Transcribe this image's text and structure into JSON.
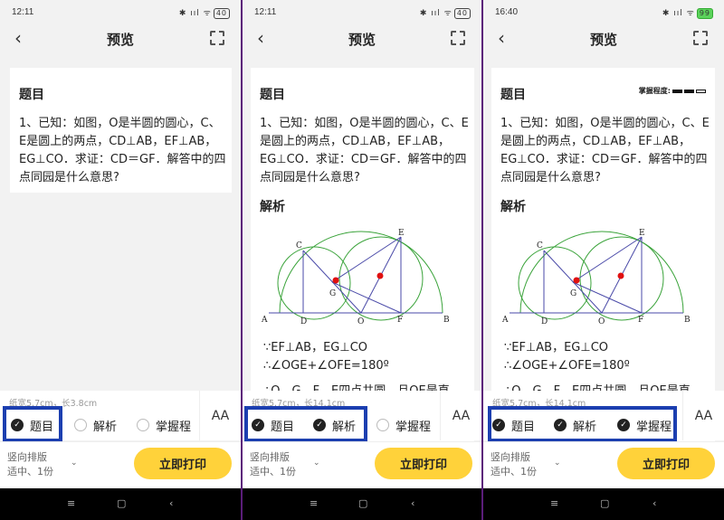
{
  "screens": [
    {
      "status": {
        "time": "12:11",
        "icons": "✱ ııl ᯤ",
        "battery": "40"
      },
      "nav": {
        "title": "预览",
        "back": "‹"
      },
      "card": {
        "heading": "题目",
        "question": "1、已知：如图，O是半圆的圆心，C、E是圆上的两点，CD⊥AB，EF⊥AB，EG⊥CO．求证：CD＝GF．解答中的四点同园是什么意思?"
      },
      "controls": {
        "paper": "纸宽5.7cm，长3.8cm",
        "options": [
          {
            "label": "题目",
            "checked": true
          },
          {
            "label": "解析",
            "checked": false
          },
          {
            "label": "掌握程",
            "checked": false
          }
        ],
        "font_button": "AA"
      },
      "bottom": {
        "layout1": "竖向排版",
        "layout2": "适中、1份",
        "print": "立即打印"
      }
    },
    {
      "status": {
        "time": "12:11",
        "icons": "✱ ııl ᯤ",
        "battery": "40"
      },
      "nav": {
        "title": "预览",
        "back": "‹"
      },
      "card": {
        "heading": "题目",
        "question": "1、已知：如图，O是半圆的圆心，C、E是圆上的两点，CD⊥AB，EF⊥AB，EG⊥CO．求证：CD＝GF．解答中的四点同园是什么意思?",
        "analysis_heading": "解析",
        "solution": [
          "∵EF⊥AB，EG⊥CO",
          "∴∠OGE+∠OFE=180º",
          "∴O、G、F、E四点共圆，且OE是直"
        ]
      },
      "controls": {
        "paper": "纸宽5.7cm，长14.1cm",
        "options": [
          {
            "label": "题目",
            "checked": true
          },
          {
            "label": "解析",
            "checked": true
          },
          {
            "label": "掌握程",
            "checked": false
          }
        ],
        "font_button": "AA"
      },
      "bottom": {
        "layout1": "竖向排版",
        "layout2": "适中、1份",
        "print": "立即打印"
      }
    },
    {
      "status": {
        "time": "16:40",
        "icons": "✱ ııl ᯤ",
        "battery": "99"
      },
      "nav": {
        "title": "预览",
        "back": "‹"
      },
      "card": {
        "mastery_label": "掌握程度:",
        "heading": "题目",
        "question": "1、已知：如图，O是半圆的圆心，C、E是圆上的两点，CD⊥AB，EF⊥AB，EG⊥CO．求证：CD＝GF．解答中的四点同园是什么意思?",
        "analysis_heading": "解析",
        "solution": [
          "∵EF⊥AB，EG⊥CO",
          "∴∠OGE+∠OFE=180º",
          "∴O、G、F、E四点共圆，且OE是直"
        ]
      },
      "controls": {
        "paper": "纸宽5.7cm，长14.1cm",
        "options": [
          {
            "label": "题目",
            "checked": true
          },
          {
            "label": "解析",
            "checked": true
          },
          {
            "label": "掌握程",
            "checked": true
          }
        ],
        "font_button": "AA"
      },
      "bottom": {
        "layout1": "竖向排版",
        "layout2": "适中、1份",
        "print": "立即打印"
      }
    }
  ],
  "diagram_labels": {
    "A": "A",
    "B": "B",
    "C": "C",
    "D": "D",
    "E": "E",
    "F": "F",
    "G": "G",
    "O": "O"
  },
  "system_nav": {
    "menu": "≡",
    "home": "▢",
    "back": "‹"
  },
  "colors": {
    "highlight": "#1c3fb0",
    "print_button": "#ffd23a",
    "circle": "#3aa33a",
    "lines": "#4a4aa8",
    "point": "#e01010"
  }
}
